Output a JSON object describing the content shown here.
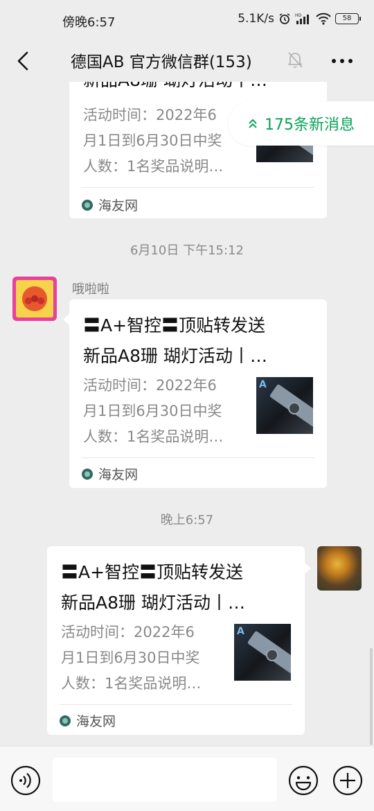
{
  "status_bar": {
    "time": "傍晚6:57",
    "speed": "5.1K/s",
    "battery": "58"
  },
  "nav": {
    "title": "德国AB  官方微信群(153)"
  },
  "new_messages": {
    "label": "175条新消息",
    "accent_color": "#07a25a"
  },
  "messages": [
    {
      "title_line2": "新品A8珊 瑚灯活动丨…",
      "desc_line1": "活动时间：2022年6",
      "desc_line2": "月1日到6月30日中奖",
      "desc_line3": "人数：1名奖品说明…",
      "source": "海友网"
    },
    {
      "timestamp": "6月10日 下午15:12",
      "sender": "哦啦啦",
      "title_line1": "〓A+智控〓顶贴转发送",
      "title_line2": "新品A8珊 瑚灯活动丨…",
      "desc_line1": "活动时间：2022年6",
      "desc_line2": "月1日到6月30日中奖",
      "desc_line3": "人数：1名奖品说明…",
      "thumb_logo": "A",
      "source": "海友网"
    },
    {
      "timestamp": "晚上6:57",
      "title_line1": "〓A+智控〓顶贴转发送",
      "title_line2": "新品A8珊 瑚灯活动丨…",
      "desc_line1": "活动时间：2022年6",
      "desc_line2": "月1日到6月30日中奖",
      "desc_line3": "人数：1名奖品说明…",
      "thumb_logo": "A",
      "source": "海友网"
    }
  ],
  "icons": {
    "back": "chevron-left-icon",
    "mute": "bell-off-icon",
    "more": "more-dots-icon",
    "voice": "voice-icon",
    "emoji": "emoji-icon",
    "plus": "plus-icon"
  }
}
